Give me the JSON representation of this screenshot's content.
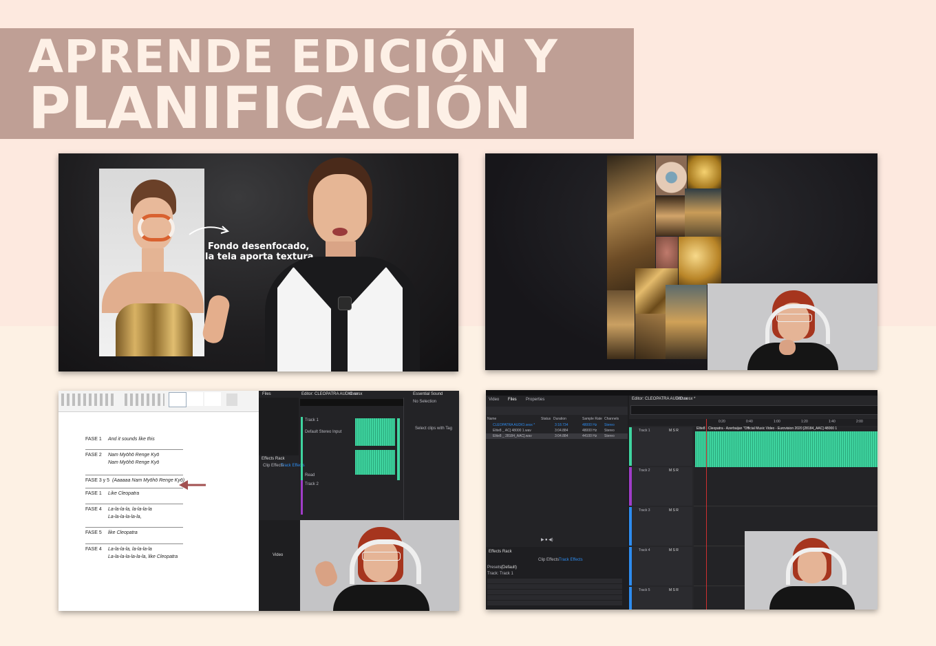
{
  "header": {
    "line1": "APRENDE EDICIÓN Y",
    "line2": "PLANIFICACIÓN"
  },
  "panel_top_left": {
    "caption_line1": "Fondo desenfocado,",
    "caption_line2": "la tela aporta textura."
  },
  "lyrics_doc": {
    "rows": [
      {
        "phase": "FASE 1",
        "lines": [
          "And it sounds like this"
        ]
      },
      {
        "phase": "FASE 2",
        "lines": [
          "Nam Myōhō Renge Kyō",
          "Nam Myōhō Renge Kyō"
        ]
      },
      {
        "phase": "FASE 3 y 5",
        "lines": [
          "(Aaaaaa Nam Myōhō Renge Kyō)"
        ]
      },
      {
        "phase": "FASE 1",
        "lines": [
          "Like Cleopatra"
        ]
      },
      {
        "phase": "FASE 4",
        "lines": [
          "La-la-la-la, la-la-la-la",
          "La-la-la-la-la-la,"
        ]
      },
      {
        "phase": "FASE 5",
        "lines": [
          "like Cleopatra"
        ]
      },
      {
        "phase": "FASE 4",
        "lines": [
          "La-la-la-la, la-la-la-la",
          "La-la-la-la-la-la-la, like Cleopatra"
        ]
      }
    ]
  },
  "audition_small": {
    "files_tab": "Files",
    "editor_tab": "Editor: CLEOPATRA AUDIO.sesx",
    "mixer_tab": "Mixer",
    "essential_sound": "Essential Sound",
    "no_selection": "No Selection",
    "select_clips": "Select clips with Tag",
    "effects_rack": "Effects Rack",
    "clip_effects": "Clip Effects",
    "track_effects": "Track Effects",
    "track1": "Track 1",
    "track2": "Track 2",
    "default_input": "Default Stereo Input",
    "read": "Read",
    "video_tab": "Video"
  },
  "audition_large": {
    "tabs": [
      "Video",
      "Files",
      "Properties"
    ],
    "editor_tab": "Editor: CLEOPATRA AUDIO.sesx *",
    "mixer_tab": "Mixer",
    "columns": [
      "Name",
      "Status",
      "Duration",
      "Sample Rate",
      "Channels"
    ],
    "files": [
      {
        "name": "CLEOPATRA AUDIO.sesx *",
        "duration": "3:18.734",
        "rate": "48000 Hz",
        "channels": "Stereo"
      },
      {
        "name": "Elite8 _ AC] 48000 1.wav",
        "duration": "3:04.884",
        "rate": "48000 Hz",
        "channels": "Stereo"
      },
      {
        "name": "Elite8 _ 28184_AAC].wav",
        "duration": "3:04.884",
        "rate": "44100 Hz",
        "channels": "Stereo"
      }
    ],
    "ruler": [
      "0:20",
      "0:40",
      "1:00",
      "1:20",
      "1:40",
      "2:00"
    ],
    "tracks": [
      "Track 1",
      "Track 2",
      "Track 3",
      "Track 4",
      "Track 5"
    ],
    "clip_title": "Elite8 - Cleopatra - Azerbaijan \"Official Music Video - Eurovision 2020 [28184_AAC] 48000 1",
    "effects_rack": "Effects Rack",
    "clip_effects": "Clip Effects",
    "track_effects": "Track Effects",
    "presets_label": "Presets:",
    "presets_value": "(Default)",
    "track_label": "Track: Track 1"
  },
  "colors": {
    "banner": "#bf9f95",
    "title_text": "#fdf0e6",
    "bg_top": "#fde9df",
    "wave_green": "#3fd5a0",
    "arrow_red": "#a25050",
    "audition_blue": "#2d8cf0"
  }
}
